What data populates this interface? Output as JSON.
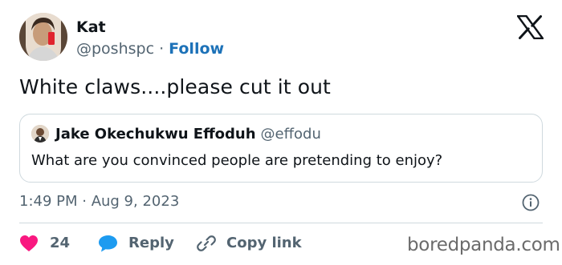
{
  "tweet": {
    "author": {
      "name": "Kat",
      "handle": "@poshspc",
      "separator": " · ",
      "follow_label": "Follow"
    },
    "text": "White claws....please cut it out",
    "quoted": {
      "name": "Jake Okechukwu Effoduh",
      "handle": "@effodu",
      "text": "What are you convinced people are pretending to enjoy?"
    },
    "timestamp": "1:49 PM · Aug 9, 2023",
    "actions": {
      "likes_count": "24",
      "reply_label": "Reply",
      "copy_link_label": "Copy link"
    }
  },
  "icons": {
    "platform_logo": "x-logo-icon",
    "info": "info-icon",
    "like": "heart-icon",
    "reply": "speech-bubble-icon",
    "copy_link": "link-icon"
  },
  "colors": {
    "text_primary": "#0f1419",
    "text_secondary": "#536471",
    "follow_blue": "#1d72b8",
    "like_pink": "#f91880",
    "reply_blue": "#1d9bf0",
    "border": "#cfd9de"
  },
  "watermark": {
    "text": "boredpanda.com"
  }
}
